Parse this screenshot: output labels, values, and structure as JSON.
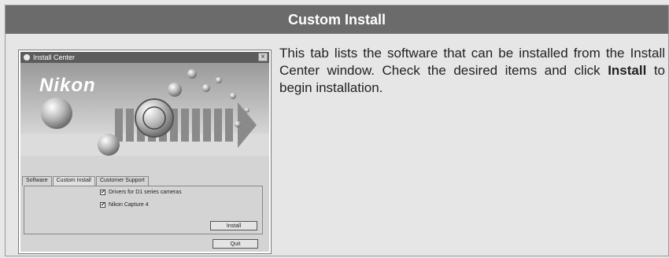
{
  "section": {
    "title": "Custom Install",
    "description_prefix": "This tab lists the software that can be installed from the Install Center window.  Check the desired items and click ",
    "description_bold": "Install",
    "description_suffix": " to begin installation."
  },
  "dialog": {
    "title": "Install Center",
    "close_glyph": "×",
    "brand": "Nikon",
    "tabs": [
      {
        "label": "Software",
        "active": false
      },
      {
        "label": "Custom Install",
        "active": true
      },
      {
        "label": "Customer Support",
        "active": false
      }
    ],
    "items": [
      {
        "label": "Drivers for D1 series cameras",
        "checked": true
      },
      {
        "label": "Nikon Capture 4",
        "checked": true
      }
    ],
    "install_button": "Install",
    "quit_button": "Quit"
  },
  "colors": {
    "header_bg": "#6b6b6b",
    "titlebar_bg": "#5c5c5c"
  },
  "icons": {
    "checkbox_checked": "✔"
  }
}
